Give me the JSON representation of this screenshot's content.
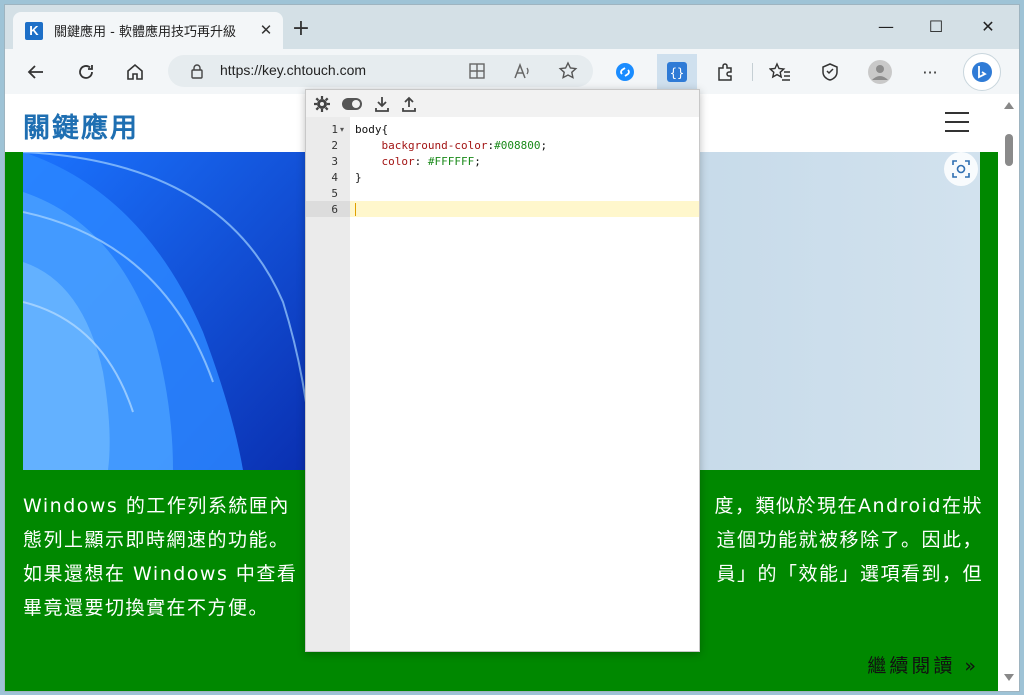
{
  "browser": {
    "tab_title": "關鍵應用 - 軟體應用技巧再升級",
    "tab_favicon_letter": "K",
    "new_tab_label": "+",
    "url": "https://key.chtouch.com",
    "window_controls": {
      "minimize": "—",
      "maximize": "☐",
      "close": "✕"
    },
    "tab_close": "✕",
    "more_label": "···"
  },
  "site": {
    "title": "關鍵應用",
    "body_lines": [
      [
        "Windows 的工作列系統匣內",
        "度，類似於現在Android在狀"
      ],
      [
        "態列上顯示即時網速的功能。",
        "這個功能就被移除了。因此，"
      ],
      [
        "如果還想在 Windows 中查看",
        "員」的「效能」選項看到，但"
      ],
      [
        "畢竟還要切換實在不方便。",
        ""
      ]
    ],
    "read_more": "繼續閱讀 »"
  },
  "editor": {
    "line_numbers": [
      "1",
      "2",
      "3",
      "4",
      "5",
      "6"
    ],
    "code": {
      "l1": "body{",
      "l2_prop": "background-color",
      "l2_colon": ":",
      "l2_val": "#008800",
      "l2_end": ";",
      "l3_prop": "color",
      "l3_colon": ": ",
      "l3_val": "#FFFFFF",
      "l3_end": ";",
      "l4": "}"
    },
    "fold_marker": "▾"
  },
  "colors": {
    "page_background": "#008800",
    "page_text": "#FFFFFF",
    "site_title": "#1f6fb2",
    "editor_active_line": "#fff7cc"
  }
}
